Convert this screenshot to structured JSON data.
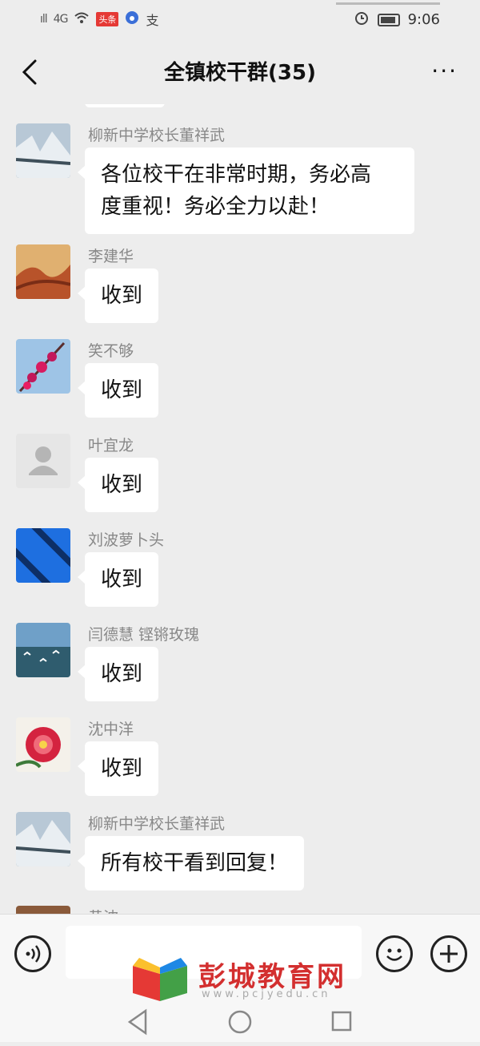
{
  "status_bar": {
    "signal_left": "ıll",
    "signal_4g": "4G",
    "app_badge": "头条",
    "misc_icon": "支",
    "time": "9:06"
  },
  "nav": {
    "title": "全镇校干群(35)",
    "more": "···"
  },
  "messages": [
    {
      "sender": "柳新中学校长董祥武",
      "lines": [
        "各位校干在非常时期，务必高",
        "度重视！务必全力以赴！"
      ],
      "avatar": "snow-river-avatar"
    },
    {
      "sender": "李建华",
      "lines": [
        "收到"
      ],
      "avatar": "great-wall-painting-avatar"
    },
    {
      "sender": "笑不够",
      "lines": [
        "收到"
      ],
      "avatar": "red-blossom-avatar"
    },
    {
      "sender": "叶宜龙",
      "lines": [
        "收到"
      ],
      "avatar": "default-user-avatar"
    },
    {
      "sender": "刘波萝卜头",
      "lines": [
        "收到"
      ],
      "avatar": "blue-stripe-avatar"
    },
    {
      "sender": "闫德慧  铿锵玫瑰",
      "lines": [
        "收到"
      ],
      "avatar": "lake-birds-avatar"
    },
    {
      "sender": "沈中洋",
      "lines": [
        "收到"
      ],
      "avatar": "peony-avatar"
    },
    {
      "sender": "柳新中学校长董祥武",
      "lines": [
        "所有校干看到回复！"
      ],
      "avatar": "snow-river-avatar"
    },
    {
      "sender": "黄波",
      "lines": [],
      "avatar": "brown-avatar"
    }
  ],
  "watermark": {
    "title": "彭城教育网",
    "url": "www.pcjyedu.cn"
  },
  "colors": {
    "background": "#ededed",
    "bubble": "#ffffff",
    "watermark_red": "#d32f2f"
  }
}
